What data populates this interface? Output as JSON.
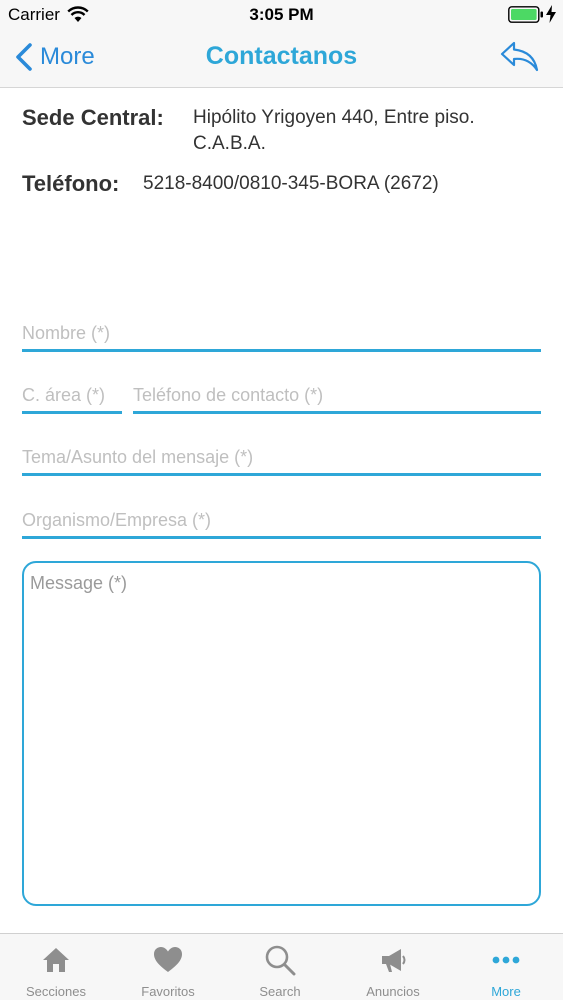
{
  "status_bar": {
    "carrier": "Carrier",
    "time": "3:05 PM"
  },
  "nav": {
    "back_label": "More",
    "title": "Contactanos"
  },
  "info": {
    "sede_label": "Sede Central:",
    "sede_value": "Hipólito Yrigoyen 440, Entre piso. C.A.B.A.",
    "telefono_label": "Teléfono:",
    "telefono_value": "5218-8400/0810-345-BORA (2672)"
  },
  "form": {
    "nombre_placeholder": "Nombre (*)",
    "area_placeholder": "C. área (*)",
    "telefono_placeholder": "Teléfono de contacto (*)",
    "tema_placeholder": "Tema/Asunto del mensaje (*)",
    "organismo_placeholder": "Organismo/Empresa (*)",
    "message_placeholder": "Message (*)"
  },
  "tabs": [
    {
      "label": "Secciones",
      "icon": "home-icon"
    },
    {
      "label": "Favoritos",
      "icon": "heart-icon"
    },
    {
      "label": "Search",
      "icon": "search-icon"
    },
    {
      "label": "Anuncios",
      "icon": "megaphone-icon"
    },
    {
      "label": "More",
      "icon": "more-dots-icon",
      "active": true
    }
  ],
  "colors": {
    "accent": "#2ea7d8",
    "link": "#2a8ad9",
    "inactive_tab": "#8e8e8e",
    "battery": "#4cd964"
  }
}
